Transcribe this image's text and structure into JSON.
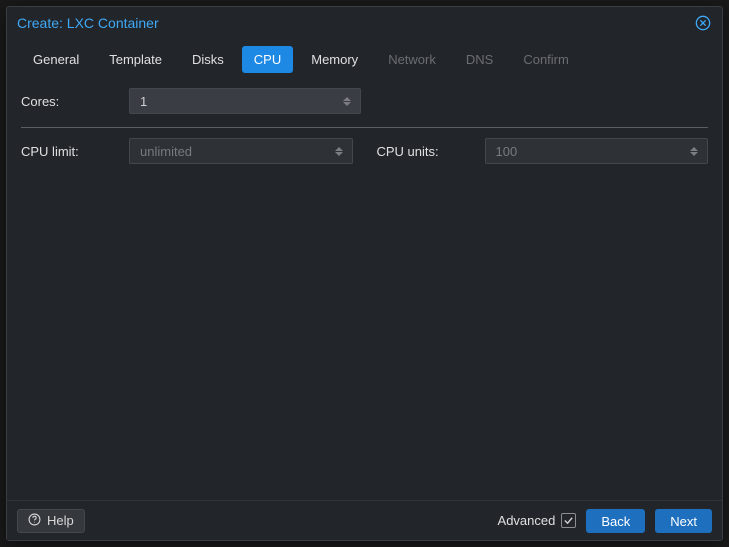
{
  "backdrop_hint": "",
  "modal": {
    "title": "Create: LXC Container",
    "tabs": [
      {
        "label": "General",
        "state": "enabled"
      },
      {
        "label": "Template",
        "state": "enabled"
      },
      {
        "label": "Disks",
        "state": "enabled"
      },
      {
        "label": "CPU",
        "state": "active"
      },
      {
        "label": "Memory",
        "state": "enabled"
      },
      {
        "label": "Network",
        "state": "disabled"
      },
      {
        "label": "DNS",
        "state": "disabled"
      },
      {
        "label": "Confirm",
        "state": "disabled"
      }
    ],
    "fields": {
      "cores": {
        "label": "Cores:",
        "value": "1",
        "placeholder": ""
      },
      "cpu_limit": {
        "label": "CPU limit:",
        "value": "",
        "placeholder": "unlimited"
      },
      "cpu_units": {
        "label": "CPU units:",
        "value": "100",
        "placeholder": ""
      }
    },
    "footer": {
      "help_label": "Help",
      "advanced_label": "Advanced",
      "advanced_checked": true,
      "back_label": "Back",
      "next_label": "Next"
    }
  }
}
